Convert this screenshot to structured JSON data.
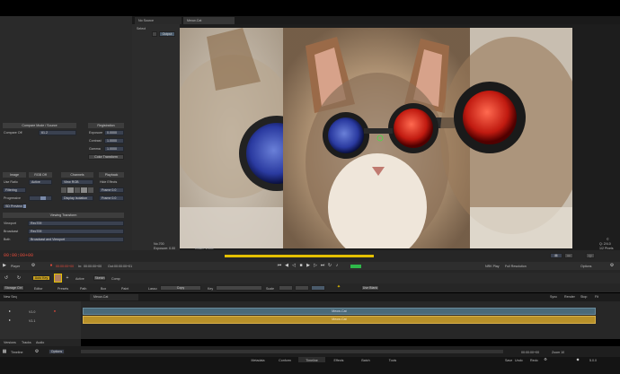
{
  "viewer": {
    "tabs": [
      "No Source",
      "Meow-Cat"
    ],
    "select_label": "Select",
    "output_label": "Output",
    "info_left": [
      "No.700",
      "Exposure: 0.00",
      "Offset: 1.000"
    ],
    "info_right": [
      "©",
      "Q: 2/4.0",
      "1/2 Pixels"
    ]
  },
  "left_panel": {
    "compare_header": "Compare Mode / Source",
    "compare_label": "Compare Off",
    "compare_value": "61.2",
    "registration_header": "Registration",
    "exposure_label": "Exposure",
    "exposure_value": "0.0000",
    "contrast_label": "Contrast",
    "contrast_value": "1.0000",
    "gamma_label": "Gamma",
    "gamma_value": "1.0000",
    "color_transform": "Color Transform",
    "image_header": "Image",
    "rgb_header": "RGB Off",
    "channels_header": "Channels",
    "playback_header": "Playback",
    "row1": [
      "Use Ratio",
      "Active",
      "View RGB",
      "Hide Effects"
    ],
    "row1_right": "Frame 0.0",
    "filtering_label": "Filtering",
    "progressive_label": "Progressive",
    "display_label": "Display Isolation",
    "playback_value": "Frame 0.0",
    "sd_preview": "SD Preview",
    "viewing_header": "Viewing Transform",
    "viewport_label": "Viewport",
    "viewport_value": "Rec709",
    "broadcast_label": "Broadcast",
    "broadcast_value": "Rec709",
    "both_label": "Both",
    "both_value": "Broadcast and Viewport"
  },
  "transport": {
    "player_label": "Player",
    "timecode_main": "00:00:00+00",
    "in_label": "In:",
    "in_value": "00:00:00+00",
    "out_label": "Out:",
    "out_value": "00:00:00+01",
    "fps_label": "NRK Play",
    "resolution": "Full Resolution",
    "options_label": "Options"
  },
  "toolbar": {
    "items": [
      "Auto Key",
      "Active",
      "Sketch",
      "Comp"
    ],
    "row2": [
      "Storage Ctrl",
      "Editor",
      "Presets",
      "Path",
      "Box",
      "Paint",
      "Lasso",
      "Copy",
      "Key",
      "Scale"
    ],
    "render_label": "Use Blank",
    "sync_label": "Sync",
    "render2": "Render",
    "stop_label": "Stop",
    "fit_label": "Fit"
  },
  "timeline": {
    "new_seq": "New Seq",
    "tab_label": "Meow-Cat",
    "track1": "V1.0",
    "track2": "V1.1",
    "clip1": "Meow-Cat",
    "clip2": "Meow-Cat",
    "bottom_tabs": [
      "Versions",
      "Tracks",
      "Audio"
    ],
    "timeline_label": "Timeline",
    "options_label": "Options",
    "timecode_right": "00:00:00+00",
    "zoom_label": "Zoom 10"
  },
  "footer": {
    "tabs": [
      "Metadata",
      "Conform",
      "Timeline",
      "Effects",
      "Batch",
      "Tools"
    ],
    "save_label": "Save",
    "undo_label": "Undo",
    "redo_label": "Redo",
    "fps_value": "5.0.0"
  },
  "colors": {
    "accent_yellow": "#e4c000",
    "clip_gold": "#b8912a",
    "clip_teal": "#4a6a7a",
    "timecode_red": "#e04a3a",
    "play_green": "#2fb84a"
  }
}
